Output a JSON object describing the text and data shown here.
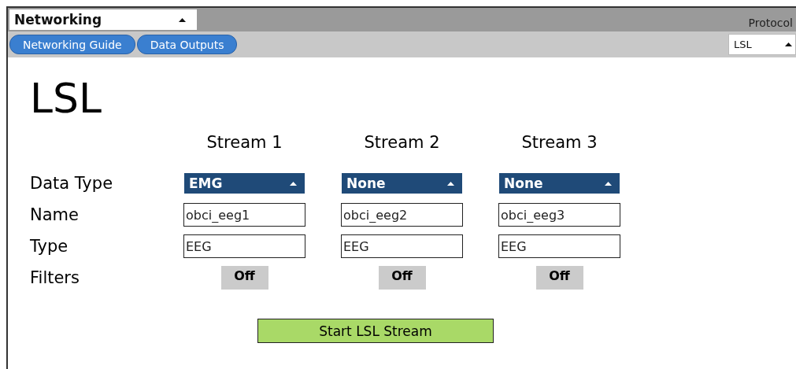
{
  "panel_selector": {
    "value": "Networking"
  },
  "protocol": {
    "label": "Protocol",
    "value": "LSL"
  },
  "nav_buttons": [
    {
      "label": "Networking Guide"
    },
    {
      "label": "Data Outputs"
    }
  ],
  "heading": "LSL",
  "row_labels": [
    "Data Type",
    "Name",
    "Type",
    "Filters"
  ],
  "streams": [
    {
      "title": "Stream 1",
      "data_type": "EMG",
      "name": "obci_eeg1",
      "type": "EEG",
      "filters": {
        "label": "Off",
        "on": false
      }
    },
    {
      "title": "Stream 2",
      "data_type": "None",
      "name": "obci_eeg2",
      "type": "EEG",
      "filters": {
        "label": "Off",
        "on": false
      }
    },
    {
      "title": "Stream 3",
      "data_type": "None",
      "name": "obci_eeg3",
      "type": "EEG",
      "filters": {
        "label": "Off",
        "on": false
      }
    }
  ],
  "start_button": {
    "label": "Start LSL Stream"
  }
}
